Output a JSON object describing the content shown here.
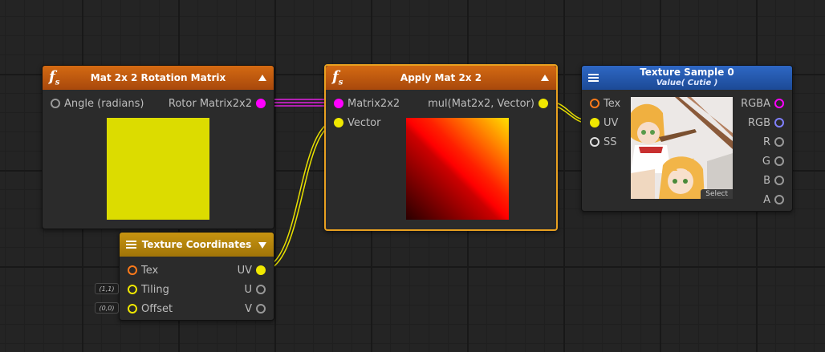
{
  "nodes": {
    "rotation_matrix": {
      "title": "Mat 2x 2 Rotation Matrix",
      "input_label": "Angle (radians)",
      "output_label": "Rotor Matrix2x2",
      "preview_color": "#dcdc00"
    },
    "apply_mat": {
      "title": "Apply Mat 2x 2",
      "inputs": [
        "Matrix2x2",
        "Vector"
      ],
      "output_label": "mul(Mat2x2, Vector)"
    },
    "texture_sample": {
      "title": "Texture Sample 0",
      "subtitle": "Value( Cutie )",
      "inputs": [
        "Tex",
        "UV",
        "SS"
      ],
      "outputs": [
        "RGBA",
        "RGB",
        "R",
        "G",
        "B",
        "A"
      ],
      "select_label": "Select"
    },
    "texture_coordinates": {
      "title": "Texture Coordinates",
      "inputs": [
        "Tex",
        "Tiling",
        "Offset"
      ],
      "outputs": [
        "UV",
        "U",
        "V"
      ],
      "tiling_value": "(1,1)",
      "offset_value": "(0,0)"
    }
  },
  "colors": {
    "matrix_port": "#ff00ff",
    "vector_port": "#f0e800",
    "texture_port": "#ff7a1a",
    "rgb_port": "#8080ff",
    "selected_border": "#e8a020"
  }
}
